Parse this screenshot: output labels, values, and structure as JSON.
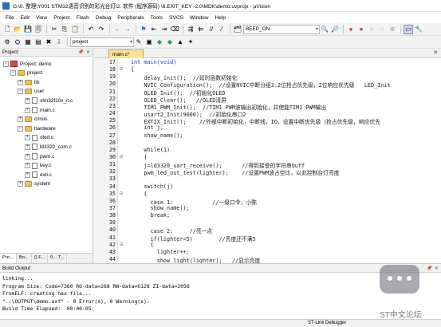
{
  "window": {
    "title": "G:\\0. 整理\\Y001 STM32语音识别的彩光台灯\\2. 软件 (程序源码) \\6.EXIT_KEY -2.0\\MDK\\demo.uvprojx - µVision"
  },
  "menu": [
    "File",
    "Edit",
    "View",
    "Project",
    "Flash",
    "Debug",
    "Peripherals",
    "Tools",
    "SVCS",
    "Window",
    "Help"
  ],
  "toolbar": {
    "find_value": "BEEP_ON",
    "target_value": "project"
  },
  "project_panel": {
    "title": "Project",
    "tree": [
      {
        "label": "Project: demo",
        "kind": "project",
        "depth": 0,
        "expander": "−"
      },
      {
        "label": "project",
        "kind": "folder",
        "depth": 1,
        "expander": "−"
      },
      {
        "label": "lib",
        "kind": "folder",
        "depth": 2,
        "expander": "+"
      },
      {
        "label": "user",
        "kind": "folder",
        "depth": 2,
        "expander": "−"
      },
      {
        "label": "stm32f10x_it.c",
        "kind": "file",
        "depth": 3,
        "expander": "+"
      },
      {
        "label": "main.c",
        "kind": "file",
        "depth": 3,
        "expander": "+"
      },
      {
        "label": "cmsis",
        "kind": "folder",
        "depth": 2,
        "expander": "+"
      },
      {
        "label": "hardware",
        "kind": "folder",
        "depth": 2,
        "expander": "−"
      },
      {
        "label": "oled.c",
        "kind": "file",
        "depth": 3,
        "expander": "+"
      },
      {
        "label": "ld3320_com.c",
        "kind": "file",
        "depth": 3,
        "expander": "+"
      },
      {
        "label": "pwm.c",
        "kind": "file",
        "depth": 3,
        "expander": "+"
      },
      {
        "label": "key.c",
        "kind": "file",
        "depth": 3,
        "expander": "+"
      },
      {
        "label": "exti.c",
        "kind": "file",
        "depth": 3,
        "expander": "+"
      },
      {
        "label": "system",
        "kind": "folder",
        "depth": 2,
        "expander": "+"
      }
    ],
    "tabs": [
      "Pro...",
      "Bo...",
      "{} F...",
      "0... T..."
    ]
  },
  "editor": {
    "active_tab": "main.c*",
    "lines": [
      {
        "n": "17",
        "fold": "",
        "text": "int main(void)",
        "style": "kw"
      },
      {
        "n": "18",
        "fold": "⊟",
        "text": "{",
        "style": ""
      },
      {
        "n": "19",
        "fold": "",
        "text": "    delay_init();  //延时函数初始化",
        "style": ""
      },
      {
        "n": "20",
        "fold": "",
        "text": "    NVIC_Configuration();  //设置NVIC中断分组2:2位抢占优先级，2位响应优先级   LED_Init",
        "style": ""
      },
      {
        "n": "21",
        "fold": "",
        "text": "    OLED_Init();  //初始化OLED",
        "style": ""
      },
      {
        "n": "22",
        "fold": "",
        "text": "    OLED_Clear();   //OLED清屏",
        "style": ""
      },
      {
        "n": "23",
        "fold": "",
        "text": "    TIM1_PWM_Init();  //TIM1 PWM波输出初始化，并使能TIM1 PWM输出",
        "style": ""
      },
      {
        "n": "24",
        "fold": "",
        "text": "    usart2_Init(9600);  //初始化串口2",
        "style": ""
      },
      {
        "n": "25",
        "fold": "",
        "text": "    EXTIX_Init();    //外部中断初始化，中断线，IO，设置中断优先级（抢占优先级，响应优先",
        "style": ""
      },
      {
        "n": "26",
        "fold": "",
        "text": "    int j;",
        "style": ""
      },
      {
        "n": "27",
        "fold": "",
        "text": "    show_name();",
        "style": ""
      },
      {
        "n": "28",
        "fold": "",
        "text": "",
        "style": ""
      },
      {
        "n": "29",
        "fold": "",
        "text": "    while(1)",
        "style": ""
      },
      {
        "n": "30",
        "fold": "⊟",
        "text": "    {",
        "style": ""
      },
      {
        "n": "31",
        "fold": "",
        "text": "    j=ld3320_uart_receive();      //得到接受的字符串buff",
        "style": ""
      },
      {
        "n": "32",
        "fold": "",
        "text": "    pwm_led_out_test(lighter);    //设置PWM波占空比，以此控制台灯亮度",
        "style": ""
      },
      {
        "n": "33",
        "fold": "",
        "text": "",
        "style": ""
      },
      {
        "n": "34",
        "fold": "",
        "text": "    switch(j)",
        "style": ""
      },
      {
        "n": "35",
        "fold": "⊟",
        "text": "    {",
        "style": ""
      },
      {
        "n": "36",
        "fold": "",
        "text": "      case 1:            //一级口令，小陈",
        "style": ""
      },
      {
        "n": "37",
        "fold": "",
        "text": "      show_name();",
        "style": ""
      },
      {
        "n": "38",
        "fold": "",
        "text": "      break;",
        "style": ""
      },
      {
        "n": "39",
        "fold": "",
        "text": "",
        "style": ""
      },
      {
        "n": "40",
        "fold": "",
        "text": "      case 2:     //亮一点",
        "style": ""
      },
      {
        "n": "41",
        "fold": "",
        "text": "      if(lighter<5)        //亮度还不满5",
        "style": ""
      },
      {
        "n": "42",
        "fold": "⊟",
        "text": "      {",
        "style": ""
      },
      {
        "n": "43",
        "fold": "",
        "text": "        lighter++;",
        "style": ""
      },
      {
        "n": "44",
        "fold": "",
        "text": "        show_light(lighter);   //显示亮度",
        "style": ""
      }
    ]
  },
  "build_output": {
    "title": "Build Output",
    "lines": [
      "linking...",
      "Program Size: Code=7360 RO-data=268 RW-data=6128 ZI-data=2056",
      "FromELF: creating hex file...",
      "\"..\\OUTPUT\\demo.axf\" - 0 Error(s), 0 Warning(s).",
      "Build Time Elapsed:  00:00:05"
    ]
  },
  "statusbar": {
    "debugger": "ST-Link Debugger"
  },
  "watermark": {
    "text": "ST中文论坛"
  }
}
